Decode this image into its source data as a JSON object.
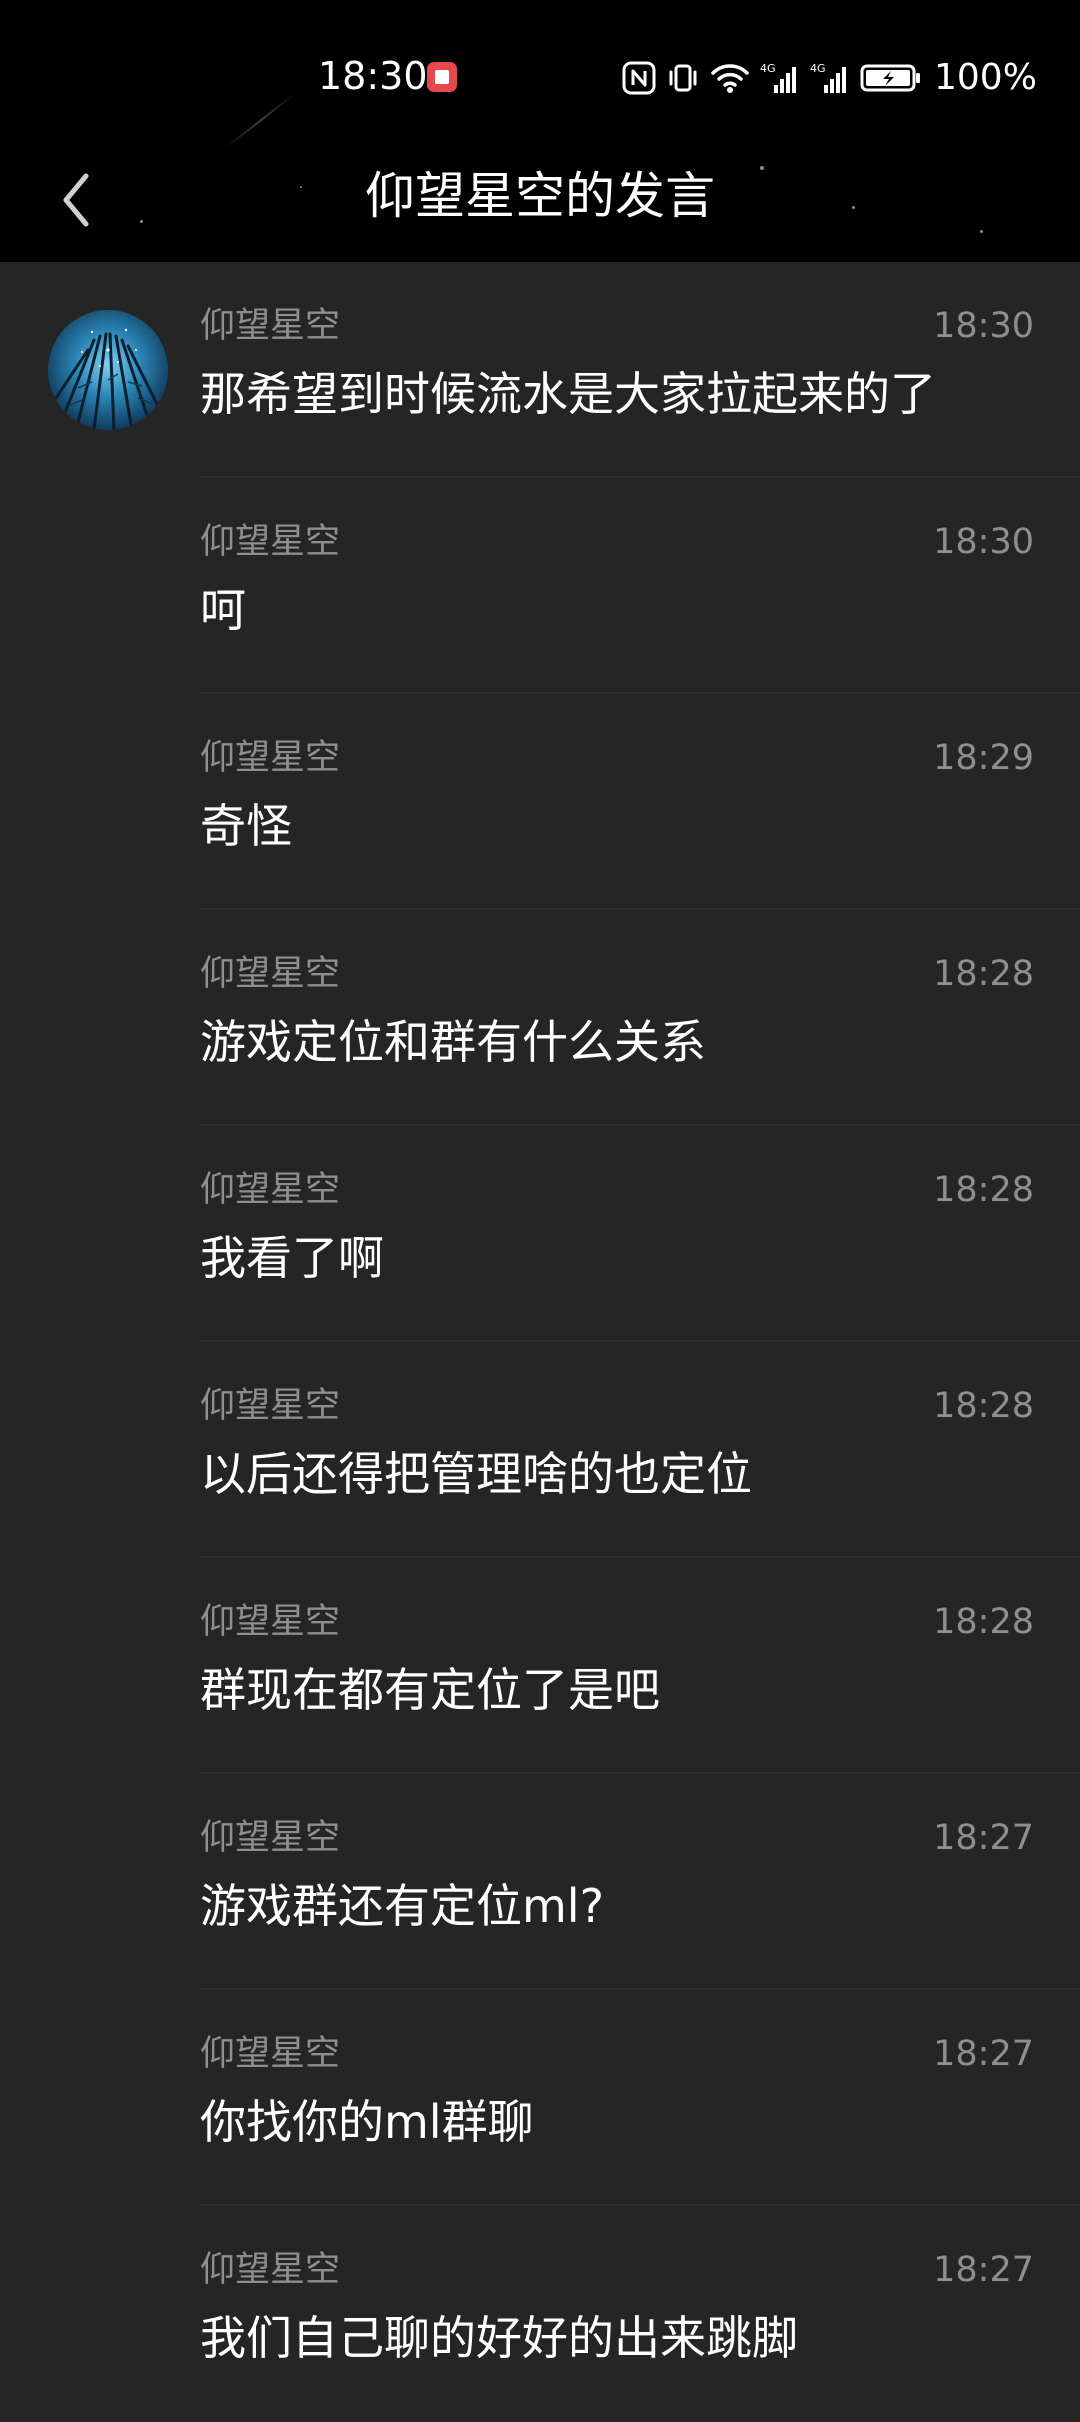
{
  "status_bar": {
    "time": "18:30",
    "battery": "100%",
    "icons": [
      "app-notification-icon",
      "nfc-icon",
      "vibrate-icon",
      "wifi-icon",
      "signal-4g-icon",
      "signal-4g-icon",
      "battery-charging-icon"
    ]
  },
  "header": {
    "title": "仰望星空的发言",
    "back_icon": "chevron-left-icon"
  },
  "messages": [
    {
      "sender": "仰望星空",
      "time": "18:30",
      "text": "那希望到时候流水是大家拉起来的了"
    },
    {
      "sender": "仰望星空",
      "time": "18:30",
      "text": "呵"
    },
    {
      "sender": "仰望星空",
      "time": "18:29",
      "text": "奇怪"
    },
    {
      "sender": "仰望星空",
      "time": "18:28",
      "text": "游戏定位和群有什么关系"
    },
    {
      "sender": "仰望星空",
      "time": "18:28",
      "text": "我看了啊"
    },
    {
      "sender": "仰望星空",
      "time": "18:28",
      "text": "以后还得把管理啥的也定位"
    },
    {
      "sender": "仰望星空",
      "time": "18:28",
      "text": "群现在都有定位了是吧"
    },
    {
      "sender": "仰望星空",
      "time": "18:27",
      "text": "游戏群还有定位ml?"
    },
    {
      "sender": "仰望星空",
      "time": "18:27",
      "text": "你找你的ml群聊"
    },
    {
      "sender": "仰望星空",
      "time": "18:27",
      "text": "我们自己聊的好好的出来跳脚"
    }
  ],
  "colors": {
    "header_bg": "#000000",
    "list_bg": "#252525",
    "primary_text": "#ffffff",
    "secondary_text": "#8f8f8f",
    "divider": "#303030",
    "notification_red": "#e5484d"
  }
}
